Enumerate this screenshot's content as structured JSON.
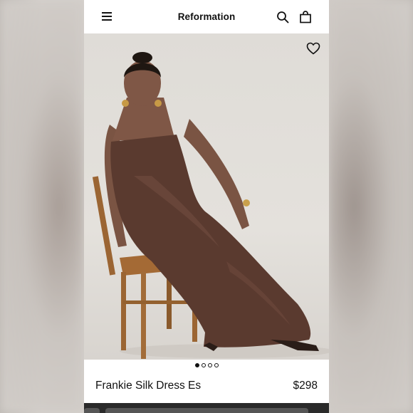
{
  "header": {
    "brand": "Reformation",
    "menu_icon": "hamburger-menu-icon",
    "search_icon": "search-icon",
    "bag_icon": "shopping-bag-icon"
  },
  "gallery": {
    "favorite_icon": "heart-icon",
    "pager": {
      "total": 4,
      "active_index": 0
    }
  },
  "product": {
    "name": "Frankie Silk Dress Es",
    "price": "$298"
  },
  "colors": {
    "dress": "#5a3a2f",
    "background": "#e2dfda",
    "text": "#111111"
  }
}
